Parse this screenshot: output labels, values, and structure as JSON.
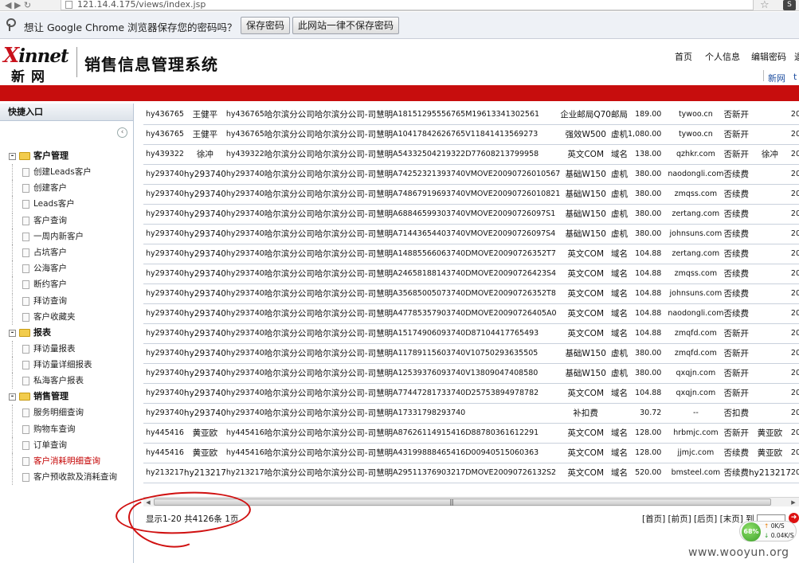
{
  "browser": {
    "url": "121.14.4.175/views/index.jsp",
    "extension_label": "S"
  },
  "infobar": {
    "message": "想让 Google Chrome 浏览器保存您的密码吗？",
    "save_label": "保存密码",
    "never_label": "此网站一律不保存密码"
  },
  "header": {
    "logo_x": "X",
    "logo_rest": "innet",
    "logo_cn": "新网",
    "app_title": "销售信息管理系统",
    "nav": [
      "首页",
      "个人信息",
      "编辑密码",
      "退"
    ],
    "subnav": [
      "新网",
      "t"
    ]
  },
  "sidebar": {
    "title": "快捷入口",
    "collapse_glyph": "‹",
    "groups": [
      {
        "label": "客户管理",
        "items": [
          "创建Leads客户",
          "创建客户",
          "Leads客户",
          "客户查询",
          "一周内新客户",
          "占坑客户",
          "公海客户",
          "断约客户",
          "拜访查询",
          "客户收藏夹"
        ]
      },
      {
        "label": "报表",
        "items": [
          "拜访量报表",
          "拜访量详细报表",
          "私海客户报表"
        ]
      },
      {
        "label": "销售管理",
        "items": [
          "服务明细查询",
          "购物车查询",
          "订单查询",
          "客户消耗明细查询",
          "客户预收款及消耗查询"
        ]
      }
    ]
  },
  "table": {
    "rows": [
      [
        "hy436765",
        "王健平",
        "hy436765",
        "哈尔滨分公司",
        "哈尔滨分公司-司慧明",
        "A18151295556765",
        "M19613341302561",
        "企业邮局Q70",
        "邮局",
        "189.00",
        "tywoo.cn",
        "否",
        "新开",
        "",
        "20"
      ],
      [
        "hy436765",
        "王健平",
        "hy436765",
        "哈尔滨分公司",
        "哈尔滨分公司-司慧明",
        "A10417842626765",
        "V11841413569273",
        "强效W500",
        "虚机",
        "1,080.00",
        "tywoo.cn",
        "否",
        "新开",
        "",
        "20"
      ],
      [
        "hy439322",
        "徐冲",
        "hy439322",
        "哈尔滨分公司",
        "哈尔滨分公司-司慧明",
        "A54332504219322",
        "D77608213799958",
        "英文COM",
        "域名",
        "138.00",
        "qzhkr.com",
        "否",
        "新开",
        "徐冲",
        "20"
      ],
      [
        "hy293740",
        "hy293740",
        "hy293740",
        "哈尔滨分公司",
        "哈尔滨分公司-司慧明",
        "A74252321393740",
        "VMOVE20090726010567",
        "基础W150",
        "虚机",
        "380.00",
        "naodongli.com",
        "否",
        "续费",
        "",
        "20"
      ],
      [
        "hy293740",
        "hy293740",
        "hy293740",
        "哈尔滨分公司",
        "哈尔滨分公司-司慧明",
        "A74867919693740",
        "VMOVE20090726010821",
        "基础W150",
        "虚机",
        "380.00",
        "zmqss.com",
        "否",
        "续费",
        "",
        "20"
      ],
      [
        "hy293740",
        "hy293740",
        "hy293740",
        "哈尔滨分公司",
        "哈尔滨分公司-司慧明",
        "A68846599303740",
        "VMOVE20090726097S1",
        "基础W150",
        "虚机",
        "380.00",
        "zertang.com",
        "否",
        "续费",
        "",
        "20"
      ],
      [
        "hy293740",
        "hy293740",
        "hy293740",
        "哈尔滨分公司",
        "哈尔滨分公司-司慧明",
        "A71443654403740",
        "VMOVE20090726097S4",
        "基础W150",
        "虚机",
        "380.00",
        "johnsuns.com",
        "否",
        "续费",
        "",
        "20"
      ],
      [
        "hy293740",
        "hy293740",
        "hy293740",
        "哈尔滨分公司",
        "哈尔滨分公司-司慧明",
        "A14885566063740",
        "DMOVE20090726352T7",
        "英文COM",
        "域名",
        "104.88",
        "zertang.com",
        "否",
        "续费",
        "",
        "20"
      ],
      [
        "hy293740",
        "hy293740",
        "hy293740",
        "哈尔滨分公司",
        "哈尔滨分公司-司慧明",
        "A24658188143740",
        "DMOVE20090726423S4",
        "英文COM",
        "域名",
        "104.88",
        "zmqss.com",
        "否",
        "续费",
        "",
        "20"
      ],
      [
        "hy293740",
        "hy293740",
        "hy293740",
        "哈尔滨分公司",
        "哈尔滨分公司-司慧明",
        "A35685005073740",
        "DMOVE20090726352T8",
        "英文COM",
        "域名",
        "104.88",
        "johnsuns.com",
        "否",
        "续费",
        "",
        "20"
      ],
      [
        "hy293740",
        "hy293740",
        "hy293740",
        "哈尔滨分公司",
        "哈尔滨分公司-司慧明",
        "A47785357903740",
        "DMOVE20090726405A0",
        "英文COM",
        "域名",
        "104.88",
        "naodongli.com",
        "否",
        "续费",
        "",
        "20"
      ],
      [
        "hy293740",
        "hy293740",
        "hy293740",
        "哈尔滨分公司",
        "哈尔滨分公司-司慧明",
        "A15174906093740",
        "D87104417765493",
        "英文COM",
        "域名",
        "104.88",
        "zmqfd.com",
        "否",
        "新开",
        "",
        "20"
      ],
      [
        "hy293740",
        "hy293740",
        "hy293740",
        "哈尔滨分公司",
        "哈尔滨分公司-司慧明",
        "A11789115603740",
        "V10750293635505",
        "基础W150",
        "虚机",
        "380.00",
        "zmqfd.com",
        "否",
        "新开",
        "",
        "20"
      ],
      [
        "hy293740",
        "hy293740",
        "hy293740",
        "哈尔滨分公司",
        "哈尔滨分公司-司慧明",
        "A12539376093740",
        "V13809047408580",
        "基础W150",
        "虚机",
        "380.00",
        "qxqjn.com",
        "否",
        "新开",
        "",
        "20"
      ],
      [
        "hy293740",
        "hy293740",
        "hy293740",
        "哈尔滨分公司",
        "哈尔滨分公司-司慧明",
        "A77447281733740",
        "D25753894978782",
        "英文COM",
        "域名",
        "104.88",
        "qxqjn.com",
        "否",
        "新开",
        "",
        "20"
      ],
      [
        "hy293740",
        "hy293740",
        "hy293740",
        "哈尔滨分公司",
        "哈尔滨分公司-司慧明",
        "A17331798293740",
        "",
        "补扣费",
        "",
        "30.72",
        "--",
        "否",
        "扣费",
        "",
        "20"
      ],
      [
        "hy445416",
        "黄亚欧",
        "hy445416",
        "哈尔滨分公司",
        "哈尔滨分公司-司慧明",
        "A87626114915416",
        "D88780361612291",
        "英文COM",
        "域名",
        "128.00",
        "hrbmjc.com",
        "否",
        "新开",
        "黄亚欧",
        "20"
      ],
      [
        "hy445416",
        "黄亚欧",
        "hy445416",
        "哈尔滨分公司",
        "哈尔滨分公司-司慧明",
        "A43199888465416",
        "D00940515060363",
        "英文COM",
        "域名",
        "128.00",
        "jjmjc.com",
        "否",
        "续费",
        "黄亚欧",
        "20"
      ],
      [
        "hy213217",
        "hy213217",
        "hy213217",
        "哈尔滨分公司",
        "哈尔滨分公司-司慧明",
        "A29511376903217",
        "DMOVE20090726132S2",
        "英文COM",
        "域名",
        "520.00",
        "bmsteel.com",
        "否",
        "续费",
        "hy213217",
        "20"
      ]
    ]
  },
  "scrollbar": {
    "grip": "|||"
  },
  "pager": {
    "summary": "显示1-20 共4126条 1页",
    "links": "[首页] [前页] [后页] [末页] 到",
    "go_glyph": "➜"
  },
  "speed_widget": {
    "percent": "68%",
    "up": "0K/S",
    "down": "0.04K/S",
    "up_arrow": "↑",
    "down_arrow": "↓"
  },
  "watermark": "www.wooyun.org"
}
